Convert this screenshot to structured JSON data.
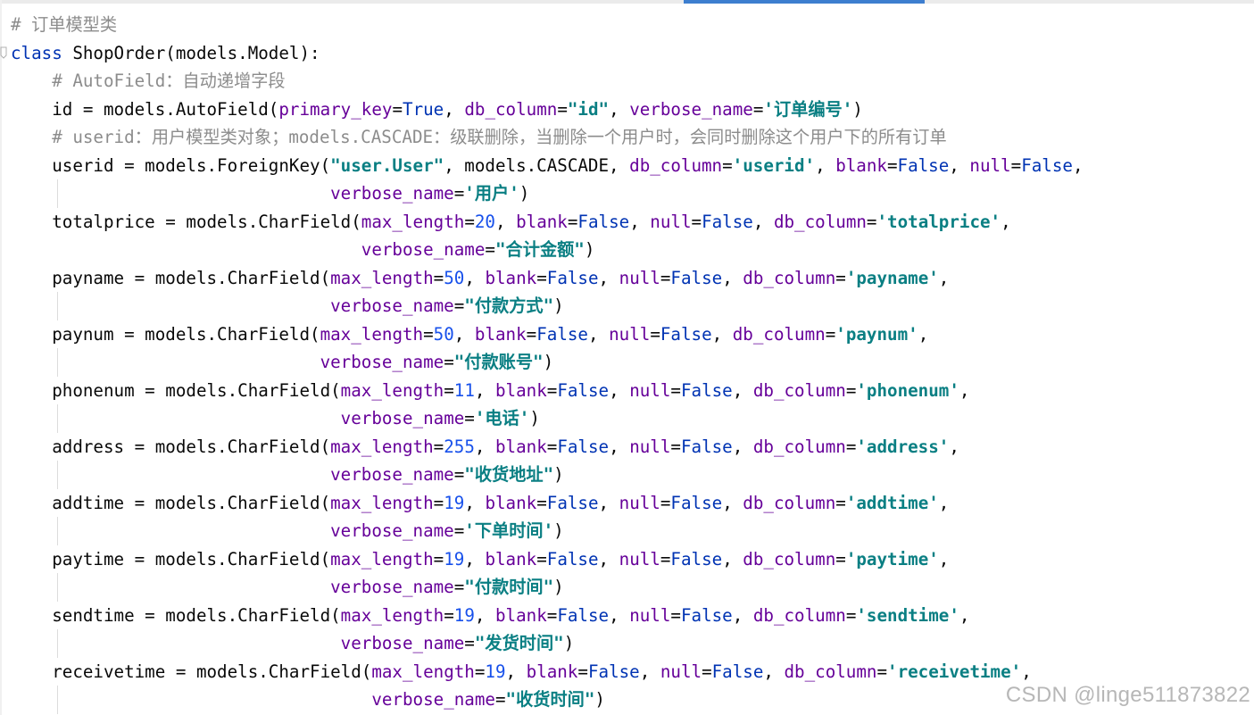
{
  "colors": {
    "background": "#ffffff",
    "comment": "#8c8c8c",
    "keyword": "#0033b3",
    "keyword_argument": "#660099",
    "string": "#067d17",
    "string_alt": "#0a7f83",
    "number": "#1750eb",
    "tab_indicator": "#3d7ecf"
  },
  "icons": {
    "fold_marker": "fold-arrow-icon"
  },
  "lines": [
    {
      "indent": 0,
      "tokens": [
        {
          "t": "# 订单模型类",
          "k": "comment"
        }
      ]
    },
    {
      "indent": 0,
      "tokens": [
        {
          "t": "class",
          "k": "kw"
        },
        {
          "t": " ShopOrder(models.Model):",
          "k": "plain"
        }
      ]
    },
    {
      "indent": 4,
      "tokens": [
        {
          "t": "# AutoField：自动递增字段",
          "k": "comment"
        }
      ]
    },
    {
      "indent": 4,
      "tokens": [
        {
          "t": "id = models.AutoField(",
          "k": "plain"
        },
        {
          "t": "primary_key",
          "k": "kwarg"
        },
        {
          "t": "=",
          "k": "plain"
        },
        {
          "t": "True",
          "k": "const"
        },
        {
          "t": ", ",
          "k": "plain"
        },
        {
          "t": "db_column",
          "k": "kwarg"
        },
        {
          "t": "=",
          "k": "plain"
        },
        {
          "t": "\"id\"",
          "k": "str-alt"
        },
        {
          "t": ", ",
          "k": "plain"
        },
        {
          "t": "verbose_name",
          "k": "kwarg"
        },
        {
          "t": "=",
          "k": "plain"
        },
        {
          "t": "'订单编号'",
          "k": "str-alt"
        },
        {
          "t": ")",
          "k": "plain"
        }
      ]
    },
    {
      "indent": 4,
      "tokens": [
        {
          "t": "# userid：用户模型类对象；models.CASCADE：级联删除，当删除一个用户时，会同时删除这个用户下的所有订单",
          "k": "comment"
        }
      ]
    },
    {
      "indent": 4,
      "tokens": [
        {
          "t": "userid = models.ForeignKey(",
          "k": "plain"
        },
        {
          "t": "\"user.User\"",
          "k": "str-alt"
        },
        {
          "t": ", models.CASCADE, ",
          "k": "plain"
        },
        {
          "t": "db_column",
          "k": "kwarg"
        },
        {
          "t": "=",
          "k": "plain"
        },
        {
          "t": "'userid'",
          "k": "str-alt"
        },
        {
          "t": ", ",
          "k": "plain"
        },
        {
          "t": "blank",
          "k": "kwarg"
        },
        {
          "t": "=",
          "k": "plain"
        },
        {
          "t": "False",
          "k": "const"
        },
        {
          "t": ", ",
          "k": "plain"
        },
        {
          "t": "null",
          "k": "kwarg"
        },
        {
          "t": "=",
          "k": "plain"
        },
        {
          "t": "False",
          "k": "const"
        },
        {
          "t": ",",
          "k": "plain"
        }
      ]
    },
    {
      "indent": 31,
      "guide": true,
      "tokens": [
        {
          "t": "verbose_name",
          "k": "kwarg"
        },
        {
          "t": "=",
          "k": "plain"
        },
        {
          "t": "'用户'",
          "k": "str-alt"
        },
        {
          "t": ")",
          "k": "plain"
        }
      ]
    },
    {
      "indent": 4,
      "tokens": [
        {
          "t": "totalprice = models.CharField(",
          "k": "plain"
        },
        {
          "t": "max_length",
          "k": "kwarg"
        },
        {
          "t": "=",
          "k": "plain"
        },
        {
          "t": "20",
          "k": "num"
        },
        {
          "t": ", ",
          "k": "plain"
        },
        {
          "t": "blank",
          "k": "kwarg"
        },
        {
          "t": "=",
          "k": "plain"
        },
        {
          "t": "False",
          "k": "const"
        },
        {
          "t": ", ",
          "k": "plain"
        },
        {
          "t": "null",
          "k": "kwarg"
        },
        {
          "t": "=",
          "k": "plain"
        },
        {
          "t": "False",
          "k": "const"
        },
        {
          "t": ", ",
          "k": "plain"
        },
        {
          "t": "db_column",
          "k": "kwarg"
        },
        {
          "t": "=",
          "k": "plain"
        },
        {
          "t": "'totalprice'",
          "k": "str-alt"
        },
        {
          "t": ",",
          "k": "plain"
        }
      ]
    },
    {
      "indent": 34,
      "tokens": [
        {
          "t": "verbose_name",
          "k": "kwarg"
        },
        {
          "t": "=",
          "k": "plain"
        },
        {
          "t": "\"合计金额\"",
          "k": "str-alt"
        },
        {
          "t": ")",
          "k": "plain"
        }
      ]
    },
    {
      "indent": 4,
      "tokens": [
        {
          "t": "payname = models.CharField(",
          "k": "plain"
        },
        {
          "t": "max_length",
          "k": "kwarg"
        },
        {
          "t": "=",
          "k": "plain"
        },
        {
          "t": "50",
          "k": "num"
        },
        {
          "t": ", ",
          "k": "plain"
        },
        {
          "t": "blank",
          "k": "kwarg"
        },
        {
          "t": "=",
          "k": "plain"
        },
        {
          "t": "False",
          "k": "const"
        },
        {
          "t": ", ",
          "k": "plain"
        },
        {
          "t": "null",
          "k": "kwarg"
        },
        {
          "t": "=",
          "k": "plain"
        },
        {
          "t": "False",
          "k": "const"
        },
        {
          "t": ", ",
          "k": "plain"
        },
        {
          "t": "db_column",
          "k": "kwarg"
        },
        {
          "t": "=",
          "k": "plain"
        },
        {
          "t": "'payname'",
          "k": "str-alt"
        },
        {
          "t": ",",
          "k": "plain"
        }
      ]
    },
    {
      "indent": 31,
      "guide": true,
      "tokens": [
        {
          "t": "verbose_name",
          "k": "kwarg"
        },
        {
          "t": "=",
          "k": "plain"
        },
        {
          "t": "\"付款方式\"",
          "k": "str-alt"
        },
        {
          "t": ")",
          "k": "plain"
        }
      ]
    },
    {
      "indent": 4,
      "tokens": [
        {
          "t": "paynum = models.CharField(",
          "k": "plain"
        },
        {
          "t": "max_length",
          "k": "kwarg"
        },
        {
          "t": "=",
          "k": "plain"
        },
        {
          "t": "50",
          "k": "num"
        },
        {
          "t": ", ",
          "k": "plain"
        },
        {
          "t": "blank",
          "k": "kwarg"
        },
        {
          "t": "=",
          "k": "plain"
        },
        {
          "t": "False",
          "k": "const"
        },
        {
          "t": ", ",
          "k": "plain"
        },
        {
          "t": "null",
          "k": "kwarg"
        },
        {
          "t": "=",
          "k": "plain"
        },
        {
          "t": "False",
          "k": "const"
        },
        {
          "t": ", ",
          "k": "plain"
        },
        {
          "t": "db_column",
          "k": "kwarg"
        },
        {
          "t": "=",
          "k": "plain"
        },
        {
          "t": "'paynum'",
          "k": "str-alt"
        },
        {
          "t": ",",
          "k": "plain"
        }
      ]
    },
    {
      "indent": 30,
      "guide": true,
      "tokens": [
        {
          "t": "verbose_name",
          "k": "kwarg"
        },
        {
          "t": "=",
          "k": "plain"
        },
        {
          "t": "\"付款账号\"",
          "k": "str-alt"
        },
        {
          "t": ")",
          "k": "plain"
        }
      ]
    },
    {
      "indent": 4,
      "tokens": [
        {
          "t": "phonenum = models.CharField(",
          "k": "plain"
        },
        {
          "t": "max_length",
          "k": "kwarg"
        },
        {
          "t": "=",
          "k": "plain"
        },
        {
          "t": "11",
          "k": "num"
        },
        {
          "t": ", ",
          "k": "plain"
        },
        {
          "t": "blank",
          "k": "kwarg"
        },
        {
          "t": "=",
          "k": "plain"
        },
        {
          "t": "False",
          "k": "const"
        },
        {
          "t": ", ",
          "k": "plain"
        },
        {
          "t": "null",
          "k": "kwarg"
        },
        {
          "t": "=",
          "k": "plain"
        },
        {
          "t": "False",
          "k": "const"
        },
        {
          "t": ", ",
          "k": "plain"
        },
        {
          "t": "db_column",
          "k": "kwarg"
        },
        {
          "t": "=",
          "k": "plain"
        },
        {
          "t": "'phonenum'",
          "k": "str-alt"
        },
        {
          "t": ",",
          "k": "plain"
        }
      ]
    },
    {
      "indent": 32,
      "guide": true,
      "tokens": [
        {
          "t": "verbose_name",
          "k": "kwarg"
        },
        {
          "t": "=",
          "k": "plain"
        },
        {
          "t": "'电话'",
          "k": "str-alt"
        },
        {
          "t": ")",
          "k": "plain"
        }
      ]
    },
    {
      "indent": 4,
      "tokens": [
        {
          "t": "address = models.CharField(",
          "k": "plain"
        },
        {
          "t": "max_length",
          "k": "kwarg"
        },
        {
          "t": "=",
          "k": "plain"
        },
        {
          "t": "255",
          "k": "num"
        },
        {
          "t": ", ",
          "k": "plain"
        },
        {
          "t": "blank",
          "k": "kwarg"
        },
        {
          "t": "=",
          "k": "plain"
        },
        {
          "t": "False",
          "k": "const"
        },
        {
          "t": ", ",
          "k": "plain"
        },
        {
          "t": "null",
          "k": "kwarg"
        },
        {
          "t": "=",
          "k": "plain"
        },
        {
          "t": "False",
          "k": "const"
        },
        {
          "t": ", ",
          "k": "plain"
        },
        {
          "t": "db_column",
          "k": "kwarg"
        },
        {
          "t": "=",
          "k": "plain"
        },
        {
          "t": "'address'",
          "k": "str-alt"
        },
        {
          "t": ",",
          "k": "plain"
        }
      ]
    },
    {
      "indent": 31,
      "guide": true,
      "tokens": [
        {
          "t": "verbose_name",
          "k": "kwarg"
        },
        {
          "t": "=",
          "k": "plain"
        },
        {
          "t": "\"收货地址\"",
          "k": "str-alt"
        },
        {
          "t": ")",
          "k": "plain"
        }
      ]
    },
    {
      "indent": 4,
      "tokens": [
        {
          "t": "addtime = models.CharField(",
          "k": "plain"
        },
        {
          "t": "max_length",
          "k": "kwarg"
        },
        {
          "t": "=",
          "k": "plain"
        },
        {
          "t": "19",
          "k": "num"
        },
        {
          "t": ", ",
          "k": "plain"
        },
        {
          "t": "blank",
          "k": "kwarg"
        },
        {
          "t": "=",
          "k": "plain"
        },
        {
          "t": "False",
          "k": "const"
        },
        {
          "t": ", ",
          "k": "plain"
        },
        {
          "t": "null",
          "k": "kwarg"
        },
        {
          "t": "=",
          "k": "plain"
        },
        {
          "t": "False",
          "k": "const"
        },
        {
          "t": ", ",
          "k": "plain"
        },
        {
          "t": "db_column",
          "k": "kwarg"
        },
        {
          "t": "=",
          "k": "plain"
        },
        {
          "t": "'addtime'",
          "k": "str-alt"
        },
        {
          "t": ",",
          "k": "plain"
        }
      ]
    },
    {
      "indent": 31,
      "guide": true,
      "tokens": [
        {
          "t": "verbose_name",
          "k": "kwarg"
        },
        {
          "t": "=",
          "k": "plain"
        },
        {
          "t": "'下单时间'",
          "k": "str-alt"
        },
        {
          "t": ")",
          "k": "plain"
        }
      ]
    },
    {
      "indent": 4,
      "tokens": [
        {
          "t": "paytime = models.CharField(",
          "k": "plain"
        },
        {
          "t": "max_length",
          "k": "kwarg"
        },
        {
          "t": "=",
          "k": "plain"
        },
        {
          "t": "19",
          "k": "num"
        },
        {
          "t": ", ",
          "k": "plain"
        },
        {
          "t": "blank",
          "k": "kwarg"
        },
        {
          "t": "=",
          "k": "plain"
        },
        {
          "t": "False",
          "k": "const"
        },
        {
          "t": ", ",
          "k": "plain"
        },
        {
          "t": "null",
          "k": "kwarg"
        },
        {
          "t": "=",
          "k": "plain"
        },
        {
          "t": "False",
          "k": "const"
        },
        {
          "t": ", ",
          "k": "plain"
        },
        {
          "t": "db_column",
          "k": "kwarg"
        },
        {
          "t": "=",
          "k": "plain"
        },
        {
          "t": "'paytime'",
          "k": "str-alt"
        },
        {
          "t": ",",
          "k": "plain"
        }
      ]
    },
    {
      "indent": 31,
      "guide": true,
      "tokens": [
        {
          "t": "verbose_name",
          "k": "kwarg"
        },
        {
          "t": "=",
          "k": "plain"
        },
        {
          "t": "\"付款时间\"",
          "k": "str-alt"
        },
        {
          "t": ")",
          "k": "plain"
        }
      ]
    },
    {
      "indent": 4,
      "tokens": [
        {
          "t": "sendtime = models.CharField(",
          "k": "plain"
        },
        {
          "t": "max_length",
          "k": "kwarg"
        },
        {
          "t": "=",
          "k": "plain"
        },
        {
          "t": "19",
          "k": "num"
        },
        {
          "t": ", ",
          "k": "plain"
        },
        {
          "t": "blank",
          "k": "kwarg"
        },
        {
          "t": "=",
          "k": "plain"
        },
        {
          "t": "False",
          "k": "const"
        },
        {
          "t": ", ",
          "k": "plain"
        },
        {
          "t": "null",
          "k": "kwarg"
        },
        {
          "t": "=",
          "k": "plain"
        },
        {
          "t": "False",
          "k": "const"
        },
        {
          "t": ", ",
          "k": "plain"
        },
        {
          "t": "db_column",
          "k": "kwarg"
        },
        {
          "t": "=",
          "k": "plain"
        },
        {
          "t": "'sendtime'",
          "k": "str-alt"
        },
        {
          "t": ",",
          "k": "plain"
        }
      ]
    },
    {
      "indent": 32,
      "guide": true,
      "tokens": [
        {
          "t": "verbose_name",
          "k": "kwarg"
        },
        {
          "t": "=",
          "k": "plain"
        },
        {
          "t": "\"发货时间\"",
          "k": "str-alt"
        },
        {
          "t": ")",
          "k": "plain"
        }
      ]
    },
    {
      "indent": 4,
      "tokens": [
        {
          "t": "receivetime = models.CharField(",
          "k": "plain"
        },
        {
          "t": "max_length",
          "k": "kwarg"
        },
        {
          "t": "=",
          "k": "plain"
        },
        {
          "t": "19",
          "k": "num"
        },
        {
          "t": ", ",
          "k": "plain"
        },
        {
          "t": "blank",
          "k": "kwarg"
        },
        {
          "t": "=",
          "k": "plain"
        },
        {
          "t": "False",
          "k": "const"
        },
        {
          "t": ", ",
          "k": "plain"
        },
        {
          "t": "null",
          "k": "kwarg"
        },
        {
          "t": "=",
          "k": "plain"
        },
        {
          "t": "False",
          "k": "const"
        },
        {
          "t": ", ",
          "k": "plain"
        },
        {
          "t": "db_column",
          "k": "kwarg"
        },
        {
          "t": "=",
          "k": "plain"
        },
        {
          "t": "'receivetime'",
          "k": "str-alt"
        },
        {
          "t": ",",
          "k": "plain"
        }
      ]
    },
    {
      "indent": 35,
      "guide": true,
      "tokens": [
        {
          "t": "verbose_name",
          "k": "kwarg"
        },
        {
          "t": "=",
          "k": "plain"
        },
        {
          "t": "\"收货时间\"",
          "k": "str-alt"
        },
        {
          "t": ")",
          "k": "plain"
        }
      ]
    }
  ],
  "watermark": "CSDN @linge511873822"
}
